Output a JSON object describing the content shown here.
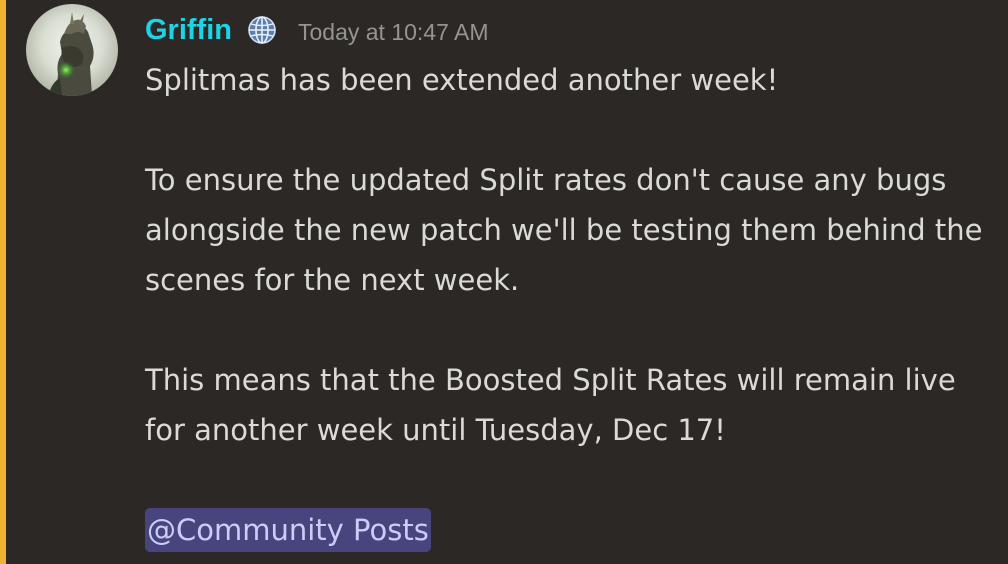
{
  "message": {
    "author": "Griffin",
    "role_icon": "globe-icon",
    "timestamp": "Today at 10:47 AM",
    "paragraphs": [
      "Splitmas has been extended another week!",
      "To ensure the updated Split rates don't cause any bugs alongside the new patch we'll be testing them behind the scenes for the next week.",
      "This means that the Boosted Split Rates will remain live for another week until Tuesday, Dec 17!"
    ],
    "mention": "@Community Posts"
  },
  "colors": {
    "background": "#2b2826",
    "highlight_bar": "#f0b232",
    "username": "#1dd3e5",
    "timestamp": "#95948f",
    "text": "#dcdad6",
    "mention_bg": "#48457e",
    "mention_text": "#c9cdf8"
  }
}
